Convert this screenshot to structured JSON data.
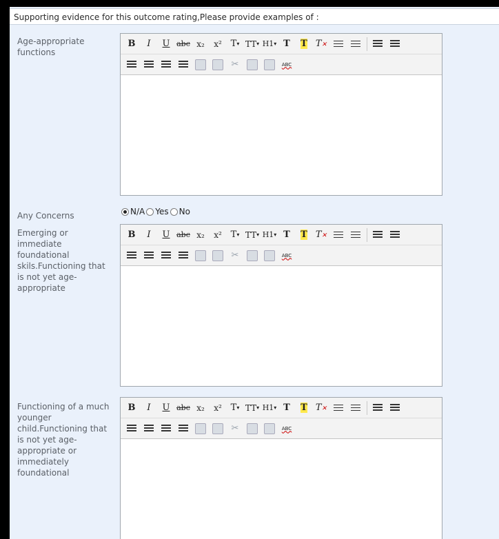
{
  "header": {
    "text": "Supporting evidence for this outcome rating,Please provide examples of :"
  },
  "fields": [
    {
      "label": "Age-appropriate functions"
    },
    {
      "label": "Emerging or immediate foundational skils.Functioning that is not yet age-appropriate"
    },
    {
      "label": "Functioning of a much younger child.Functioning that is not yet age-appropriate or immediately foundational"
    }
  ],
  "concerns": {
    "label": "Any Concerns",
    "options": [
      {
        "label": "N/A",
        "checked": true
      },
      {
        "label": "Yes",
        "checked": false
      },
      {
        "label": "No",
        "checked": false
      }
    ]
  },
  "toolbar": {
    "bold": "B",
    "italic": "I",
    "underline": "U",
    "strike": "abc",
    "subscript": "x₂",
    "superscript": "x²",
    "font_name": "T",
    "font_size": "TT",
    "heading": "H1",
    "spellcheck": "ABC"
  }
}
